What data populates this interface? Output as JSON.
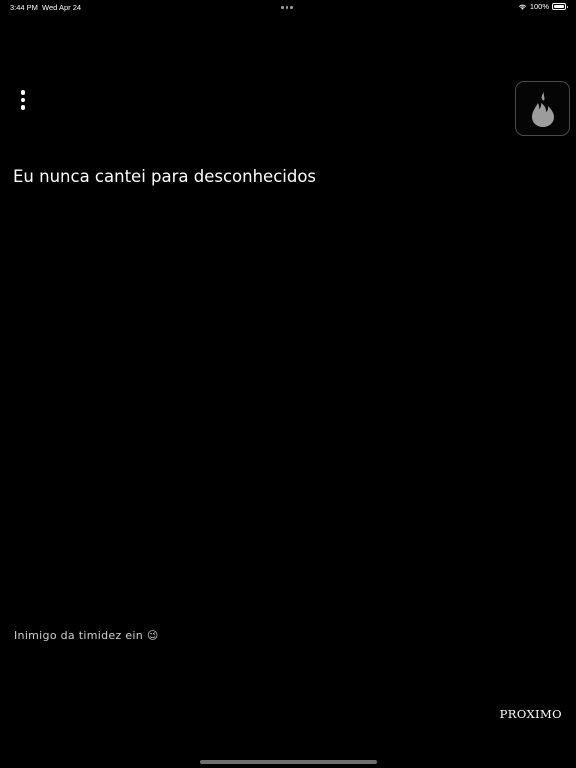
{
  "status_bar": {
    "time": "3:44 PM",
    "date": "Wed Apr 24",
    "battery": "100%"
  },
  "icons": {
    "menu": "more-vertical-icon",
    "logo": "flame-icon",
    "wifi": "wifi-icon",
    "battery": "battery-icon"
  },
  "card": {
    "question": "Eu nunca cantei para desconhecidos",
    "comment": "Inimigo da timidez ein 😉"
  },
  "footer": {
    "next_label": "PROXIMO"
  },
  "colors": {
    "background": "#000000",
    "text": "#ffffff",
    "logo_border": "#4a4a4a",
    "logo_flame": "#9c9c9c"
  }
}
